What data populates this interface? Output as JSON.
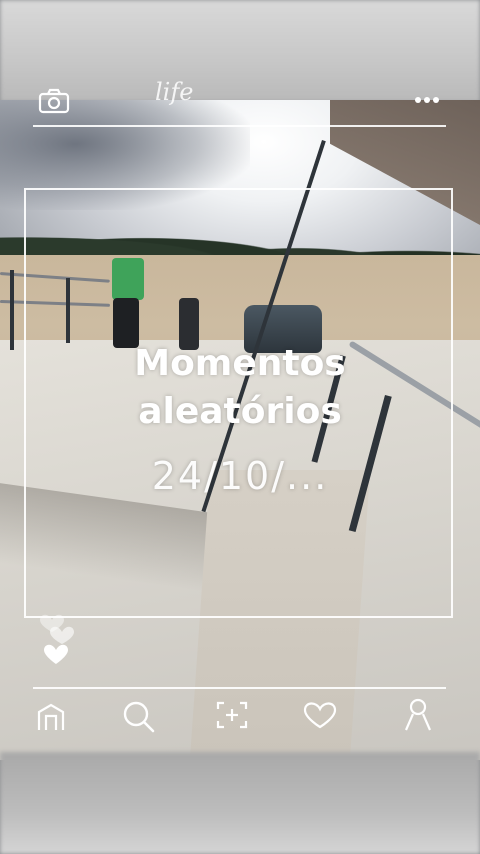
{
  "header": {
    "brand_text": "life",
    "camera_icon": "camera-icon",
    "more_icon": "more-dots-icon"
  },
  "overlay": {
    "title_line1": "Momentos",
    "title_line2": "aleatórios",
    "date": "24/10/..."
  },
  "hearts": {
    "icon": "heart-icon",
    "count_visible": 3
  },
  "bottom_nav": {
    "items": [
      {
        "name": "home",
        "icon": "home-icon"
      },
      {
        "name": "search",
        "icon": "search-icon"
      },
      {
        "name": "add",
        "icon": "add-square-icon"
      },
      {
        "name": "likes",
        "icon": "heart-outline-icon"
      },
      {
        "name": "profile",
        "icon": "profile-icon"
      }
    ]
  },
  "colors": {
    "overlay_text": "#ffffff",
    "frame_lines": "#ffffff"
  }
}
